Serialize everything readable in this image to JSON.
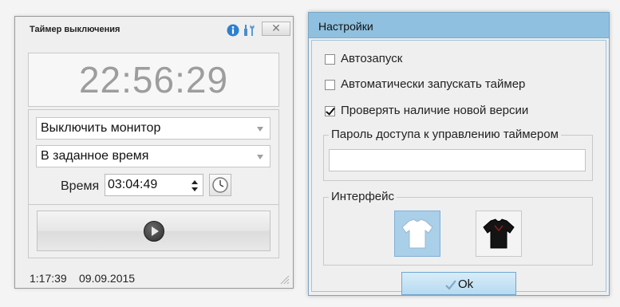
{
  "timer_window": {
    "title": "Таймер выключения",
    "close_label": "✕",
    "clock": "22:56:29",
    "action_select": {
      "selected": "Выключить монитор"
    },
    "mode_select": {
      "selected": "В заданное время"
    },
    "time_label": "Время",
    "time_value": "03:04:49",
    "status": {
      "elapsed": "1:17:39",
      "date": "09.09.2015"
    },
    "icons": {
      "info": "info-icon",
      "tools": "tools-icon",
      "clock_picker": "clock-icon",
      "start": "play-icon"
    }
  },
  "settings_window": {
    "title": "Настройки",
    "checkboxes": [
      {
        "label": "Автозапуск",
        "checked": false
      },
      {
        "label": "Автоматически запускать таймер",
        "checked": false
      },
      {
        "label": "Проверять наличие новой версии",
        "checked": true
      }
    ],
    "password_group": {
      "legend": "Пароль доступа к управлению таймером",
      "value": ""
    },
    "interface_group": {
      "legend": "Интерфейс",
      "themes": [
        {
          "icon": "white-shirt-icon",
          "selected": true
        },
        {
          "icon": "black-shirt-icon",
          "selected": false
        }
      ]
    },
    "ok_label": "Ok"
  },
  "colors": {
    "accent_titlebar": "#8fc0df",
    "selected_theme": "#aacfe9",
    "clock_text": "#9d9d9d"
  }
}
